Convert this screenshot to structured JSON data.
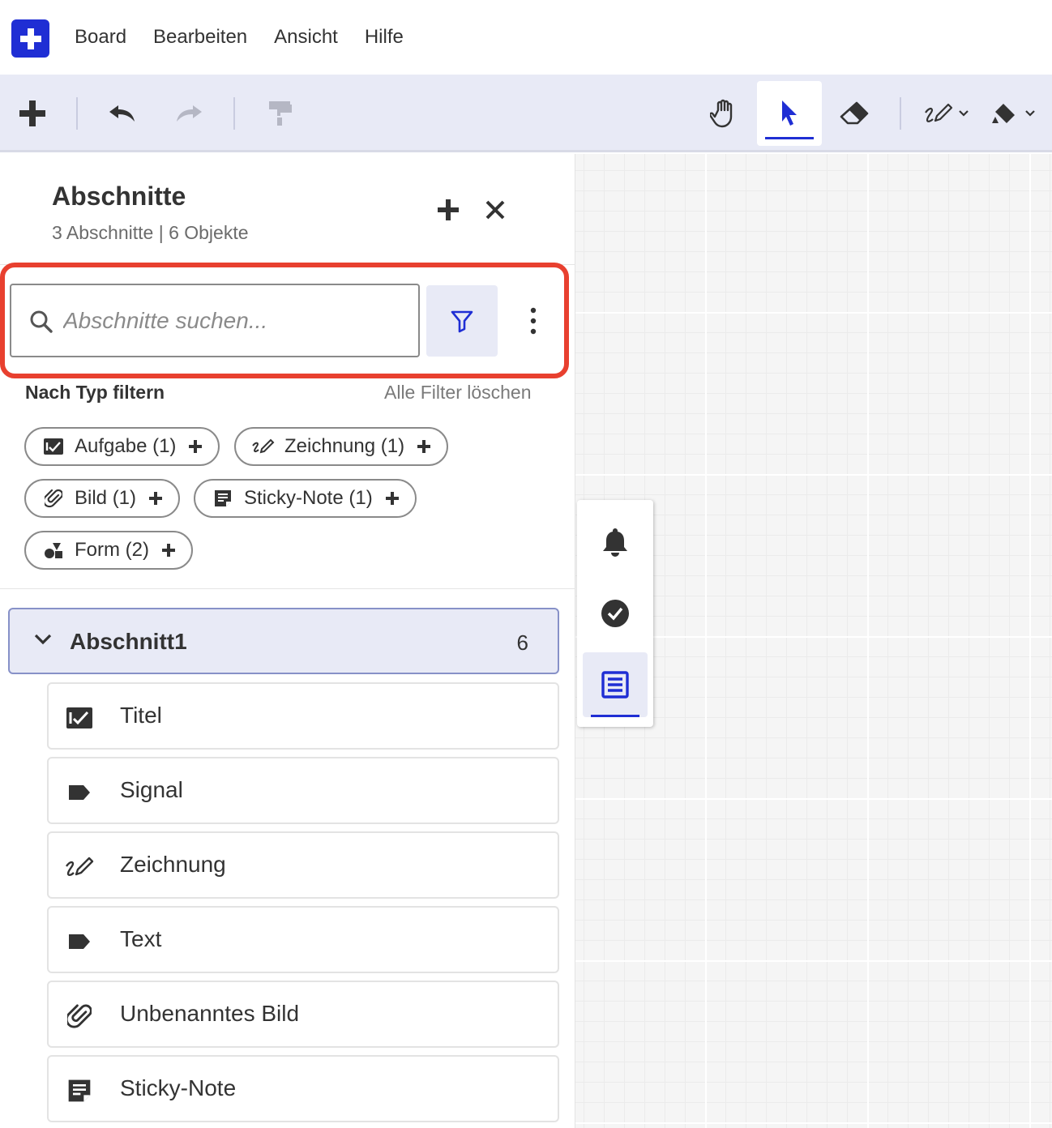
{
  "menu": {
    "items": [
      "Board",
      "Bearbeiten",
      "Ansicht",
      "Hilfe"
    ]
  },
  "toolbar": {
    "tools": [
      "add-icon",
      "undo-icon",
      "redo-icon",
      "format-painter-icon",
      "hand-icon",
      "pointer-icon",
      "eraser-icon",
      "pen-icon",
      "fill-icon"
    ],
    "active_tool": "pointer",
    "accent_color": "#1f2ed4",
    "background_color": "#e8eaf6"
  },
  "panel": {
    "title": "Abschnitte",
    "subtitle": "3 Abschnitte | 6 Objekte",
    "search": {
      "placeholder": "Abschnitte suchen...",
      "value": ""
    },
    "filter_label": "Nach Typ filtern",
    "clear_filters": "Alle Filter löschen",
    "chips": [
      {
        "label": "Aufgabe (1)",
        "icon": "task-icon"
      },
      {
        "label": "Zeichnung (1)",
        "icon": "drawing-icon"
      },
      {
        "label": "Bild (1)",
        "icon": "paperclip-icon"
      },
      {
        "label": "Sticky-Note (1)",
        "icon": "sticky-note-icon"
      },
      {
        "label": "Form (2)",
        "icon": "shapes-icon"
      }
    ],
    "section": {
      "name": "Abschnitt1",
      "count": "6",
      "expanded": true
    },
    "items": [
      {
        "label": "Titel",
        "icon": "task-icon"
      },
      {
        "label": "Signal",
        "icon": "label-icon"
      },
      {
        "label": "Zeichnung",
        "icon": "drawing-icon"
      },
      {
        "label": "Text",
        "icon": "label-icon"
      },
      {
        "label": "Unbenanntes Bild",
        "icon": "paperclip-icon"
      },
      {
        "label": "Sticky-Note",
        "icon": "sticky-note-icon"
      }
    ]
  },
  "side_tools": {
    "tools": [
      "bell-icon",
      "check-circle-icon",
      "list-icon"
    ],
    "active_tool": "list"
  },
  "highlight_color": "#e8402f"
}
